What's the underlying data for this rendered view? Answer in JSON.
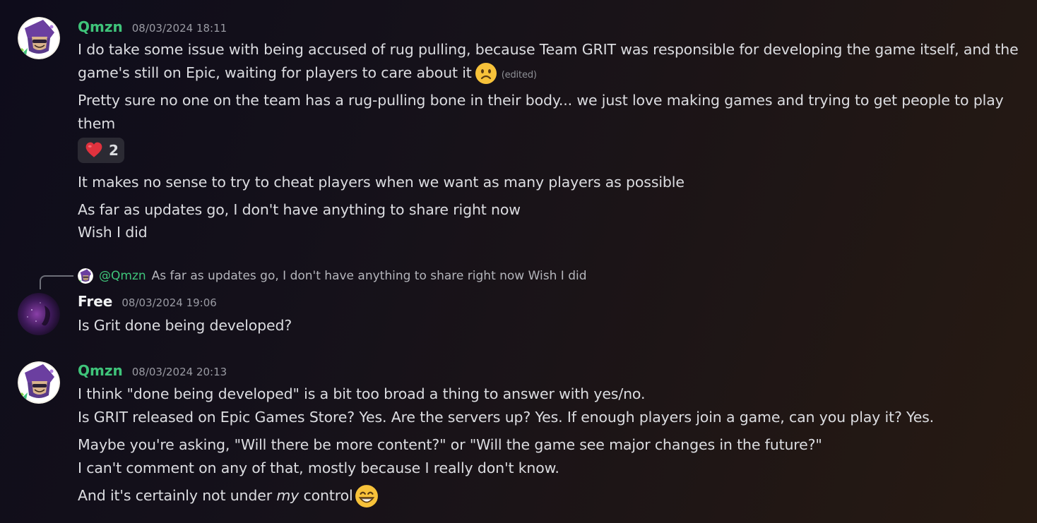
{
  "messages": [
    {
      "author": "Qmzn",
      "timestamp": "08/03/2024 18:11",
      "lines": [
        "I do take some issue with being accused of rug pulling, because Team GRIT was responsible for developing the game itself, and the",
        "game's still on Epic, waiting for players to care about it",
        "Pretty sure no one on the team has a rug-pulling bone in their body... we just love making games and trying to get people to play",
        "them",
        "It makes no sense to try to cheat players when we want as many players as possible",
        "As far as updates go, I don't have anything to share right now",
        "Wish I did"
      ],
      "edited_label": "(edited)",
      "reaction": {
        "emoji": "heart",
        "count": "2"
      }
    },
    {
      "reply": {
        "mention": "@Qmzn",
        "preview": "As far as updates go, I don't have anything to share right now Wish I did"
      },
      "author": "Free",
      "timestamp": "08/03/2024 19:06",
      "lines": [
        "Is Grit done being developed?"
      ]
    },
    {
      "author": "Qmzn",
      "timestamp": "08/03/2024 20:13",
      "lines": [
        "I think \"done being developed\" is a bit too broad a thing to answer with yes/no.",
        "Is GRIT released on Epic Games Store? Yes. Are the servers up? Yes. If enough players join a game, can you play it? Yes.",
        "Maybe you're asking, \"Will there be more content?\" or \"Will the game see major changes in the future?\"",
        "I can't comment on any of that, mostly because I really don't know.",
        "And it's certainly not under ",
        "my",
        " control"
      ]
    }
  ],
  "colors": {
    "qmzn_name": "#3fc47a",
    "free_name": "#f2f3f5",
    "reaction_bg": "#2b2a33"
  },
  "icons": [
    "wizard-avatar",
    "purple-space-avatar",
    "frowning-face-emoji",
    "red-heart-emoji",
    "grinning-face-emoji"
  ]
}
